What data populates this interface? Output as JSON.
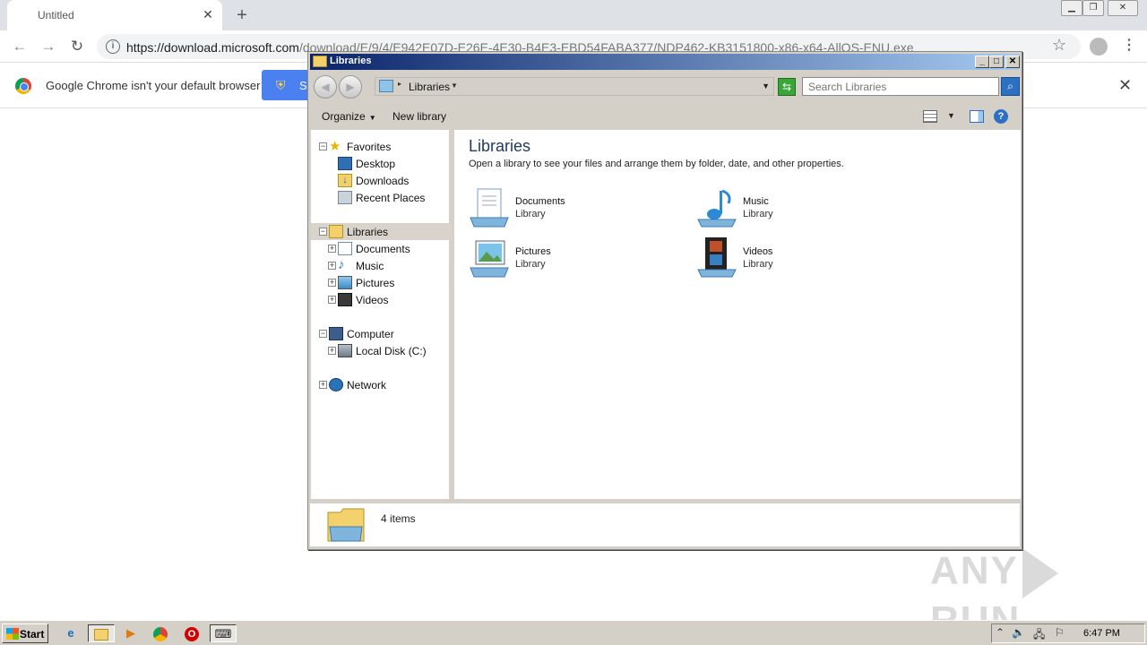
{
  "browser": {
    "tab_title": "Untitled",
    "tab_close": "✕",
    "new_tab": "+",
    "url_host": "https://download.microsoft.com",
    "url_path": "/download/E/9/4/E942E07D-E26E-4E30-B4E3-EBD54FABA377/NDP462-KB3151800-x86-x64-AllOS-ENU.exe",
    "infobar_message": "Google Chrome isn't your default browser",
    "infobar_button_label": "S",
    "infobar_close": "✕"
  },
  "explorer": {
    "title": "Libraries",
    "breadcrumb": "Libraries",
    "search_placeholder": "Search Libraries",
    "commands": {
      "organize": "Organize",
      "new_library": "New library"
    },
    "nav": {
      "favorites": "Favorites",
      "desktop": "Desktop",
      "downloads": "Downloads",
      "recent_places": "Recent Places",
      "libraries": "Libraries",
      "documents": "Documents",
      "music": "Music",
      "pictures": "Pictures",
      "videos": "Videos",
      "computer": "Computer",
      "local_disk": "Local Disk (C:)",
      "network": "Network"
    },
    "content": {
      "heading": "Libraries",
      "subtitle": "Open a library to see your files and arrange them by folder, date, and other properties.",
      "items": [
        {
          "name": "Documents",
          "type": "Library"
        },
        {
          "name": "Music",
          "type": "Library"
        },
        {
          "name": "Pictures",
          "type": "Library"
        },
        {
          "name": "Videos",
          "type": "Library"
        }
      ]
    },
    "status_count": "4 items"
  },
  "taskbar": {
    "start_label": "Start",
    "clock": "6:47 PM"
  },
  "watermark": {
    "left": "ANY",
    "right": "RUN"
  },
  "colors": {
    "title_bar_start": "#0a246a",
    "title_bar_end": "#a6caf0",
    "infobar_button": "#4a80f0",
    "classic_gray": "#d4d0c8"
  }
}
